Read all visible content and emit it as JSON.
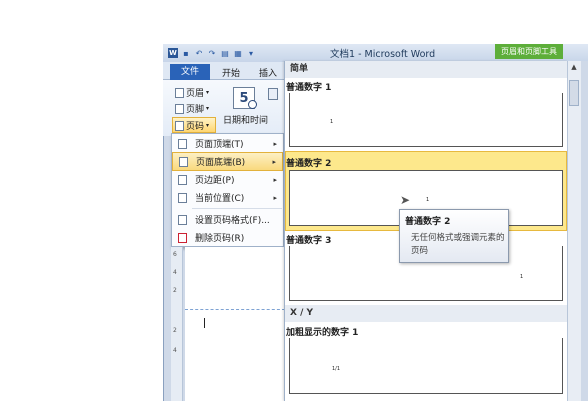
{
  "window": {
    "title": "文档1 - Microsoft Word",
    "context_tab": "页眉和页脚工具",
    "qat_icons": [
      "word-logo",
      "save-icon",
      "undo-icon",
      "redo-icon",
      "open-icon",
      "print-icon",
      "customize-icon"
    ],
    "word_logo": "W"
  },
  "ribbon": {
    "tabs": [
      "文件",
      "开始",
      "插入"
    ],
    "header_label": "页眉",
    "footer_label": "页脚",
    "page_number_label": "页码",
    "date_time_label": "日期和时间",
    "calendar_num": "5"
  },
  "menu": {
    "items": [
      {
        "label": "页面顶端(T)",
        "arrow": "▸",
        "icon": "page-top-icon"
      },
      {
        "label": "页面底端(B)",
        "arrow": "▸",
        "icon": "page-bottom-icon"
      },
      {
        "label": "页边距(P)",
        "arrow": "▸",
        "icon": "page-margin-icon"
      },
      {
        "label": "当前位置(C)",
        "arrow": "▸",
        "icon": "current-position-icon"
      },
      {
        "label": "设置页码格式(F)...",
        "arrow": "",
        "icon": "format-page-number-icon"
      },
      {
        "label": "删除页码(R)",
        "arrow": "",
        "icon": "remove-page-number-icon"
      }
    ]
  },
  "gallery": {
    "section1": "简单",
    "section2": "X / Y",
    "items": [
      {
        "label": "普通数字 1",
        "glyph": "1"
      },
      {
        "label": "普通数字 2",
        "glyph": "1"
      },
      {
        "label": "普通数字 3",
        "glyph": "1"
      },
      {
        "label": "加粗显示的数字 1",
        "glyph": "1/1"
      }
    ]
  },
  "tooltip": {
    "title": "普通数字 2",
    "body": "无任何格式或强调元素的页码"
  },
  "ruler": {
    "marks": [
      "6",
      "4",
      "2",
      "2",
      "4"
    ]
  },
  "colors": {
    "accent": "#2a63b8",
    "hover": "#fde88c",
    "context_tab": "#5dae3a"
  }
}
